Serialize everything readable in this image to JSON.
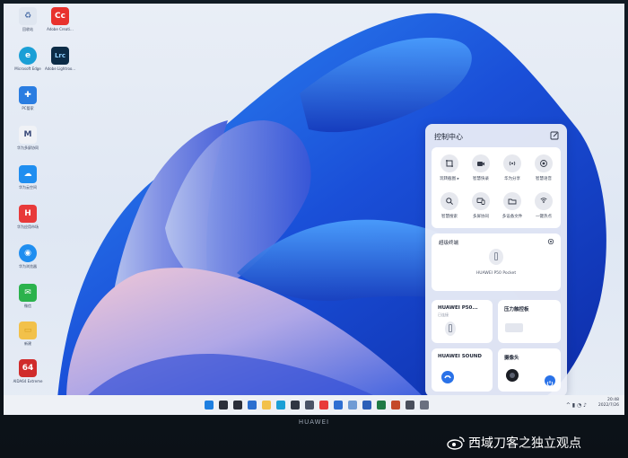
{
  "desktop_icons": [
    {
      "name": "recycle-bin-icon",
      "label": "回收站",
      "color": "#dfe6f0",
      "glyph": "♻"
    },
    {
      "name": "adobe-creative-cloud-icon",
      "label": "Adobe Creati...",
      "color": "#e8322d",
      "glyph": "Cc"
    },
    {
      "name": "microsoft-edge-icon",
      "label": "Microsoft Edge",
      "color": "#1a9fd6",
      "glyph": "e"
    },
    {
      "name": "lightroom-classic-icon",
      "label": "Adobe Lightroo...",
      "color": "#0c2c47",
      "glyph": "Lrc"
    },
    {
      "name": "pc-manager-icon",
      "label": "PC管家",
      "color": "#2a7de1",
      "glyph": "✚"
    },
    {
      "name": "huawei-multiscreen-icon",
      "label": "华为多屏协同",
      "color": "#f0f2f6",
      "glyph": "M"
    },
    {
      "name": "huawei-cloud-icon",
      "label": "华为云空间",
      "color": "#1f8ef0",
      "glyph": "☁"
    },
    {
      "name": "huawei-store-icon",
      "label": "华为应用市场",
      "color": "#e83a3a",
      "glyph": "H"
    },
    {
      "name": "huawei-browser-icon",
      "label": "华为浏览器",
      "color": "#1f8ef0",
      "glyph": "◉"
    },
    {
      "name": "wechat-icon",
      "label": "微信",
      "color": "#2bb24c",
      "glyph": "✉"
    },
    {
      "name": "folder-icon",
      "label": "新建",
      "color": "#f2c14a",
      "glyph": "▭"
    },
    {
      "name": "aida64-icon",
      "label": "AIDA64 Extreme",
      "color": "#d02b2b",
      "glyph": "64"
    }
  ],
  "control_center": {
    "title": "控制中心",
    "grid": [
      {
        "name": "screenshot",
        "icon": "crop-icon",
        "label": "玩转截图 ▸"
      },
      {
        "name": "smart-capture",
        "icon": "camera-icon",
        "label": "智慧快录"
      },
      {
        "name": "huawei-share",
        "icon": "share-icon",
        "label": "华为分享"
      },
      {
        "name": "smart-voice",
        "icon": "voice-icon",
        "label": "智慧语音"
      },
      {
        "name": "smart-search",
        "icon": "search-icon",
        "label": "智慧搜索"
      },
      {
        "name": "multi-screen",
        "icon": "multiscreen-icon",
        "label": "多屏协同"
      },
      {
        "name": "multi-device-files",
        "icon": "folder-icon",
        "label": "多设备文件"
      },
      {
        "name": "hotspot",
        "icon": "hotspot-icon",
        "label": "一键热点"
      }
    ],
    "super_device": {
      "title": "超级终端",
      "device": "HUAWEI P50 Pocket"
    },
    "phone_card": {
      "title": "HUAWEI P50...",
      "status": "已连接"
    },
    "pressure_card": {
      "title": "压力触控板"
    },
    "sound_card": {
      "title": "HUAWEI SOUND"
    },
    "camera_card": {
      "title": "摄像头"
    }
  },
  "taskbar": {
    "time": "20:48",
    "date": "2022/7/26",
    "icons": [
      {
        "name": "start-icon",
        "color": "#1e7fe0"
      },
      {
        "name": "search-icon",
        "color": "#2b2f3a"
      },
      {
        "name": "task-view-icon",
        "color": "#2b2f3a"
      },
      {
        "name": "widgets-icon",
        "color": "#2b6fcf"
      },
      {
        "name": "explorer-icon",
        "color": "#f2c14a"
      },
      {
        "name": "edge-icon",
        "color": "#1a9fd6"
      },
      {
        "name": "store-icon",
        "color": "#303642"
      },
      {
        "name": "multiscreen-icon",
        "color": "#4a5366"
      },
      {
        "name": "huawei-store-icon",
        "color": "#e83a3a"
      },
      {
        "name": "mail-icon",
        "color": "#2f6fd1"
      },
      {
        "name": "photos-icon",
        "color": "#6f9bd4"
      },
      {
        "name": "word-icon",
        "color": "#2b5fb8"
      },
      {
        "name": "excel-icon",
        "color": "#1f7a45"
      },
      {
        "name": "powerpoint-icon",
        "color": "#c44a2a"
      },
      {
        "name": "terminal-icon",
        "color": "#4a4f5c"
      },
      {
        "name": "app-icon",
        "color": "#6a7080"
      }
    ]
  },
  "laptop_brand": "HUAWEI",
  "watermark": "西域刀客之独立观点"
}
